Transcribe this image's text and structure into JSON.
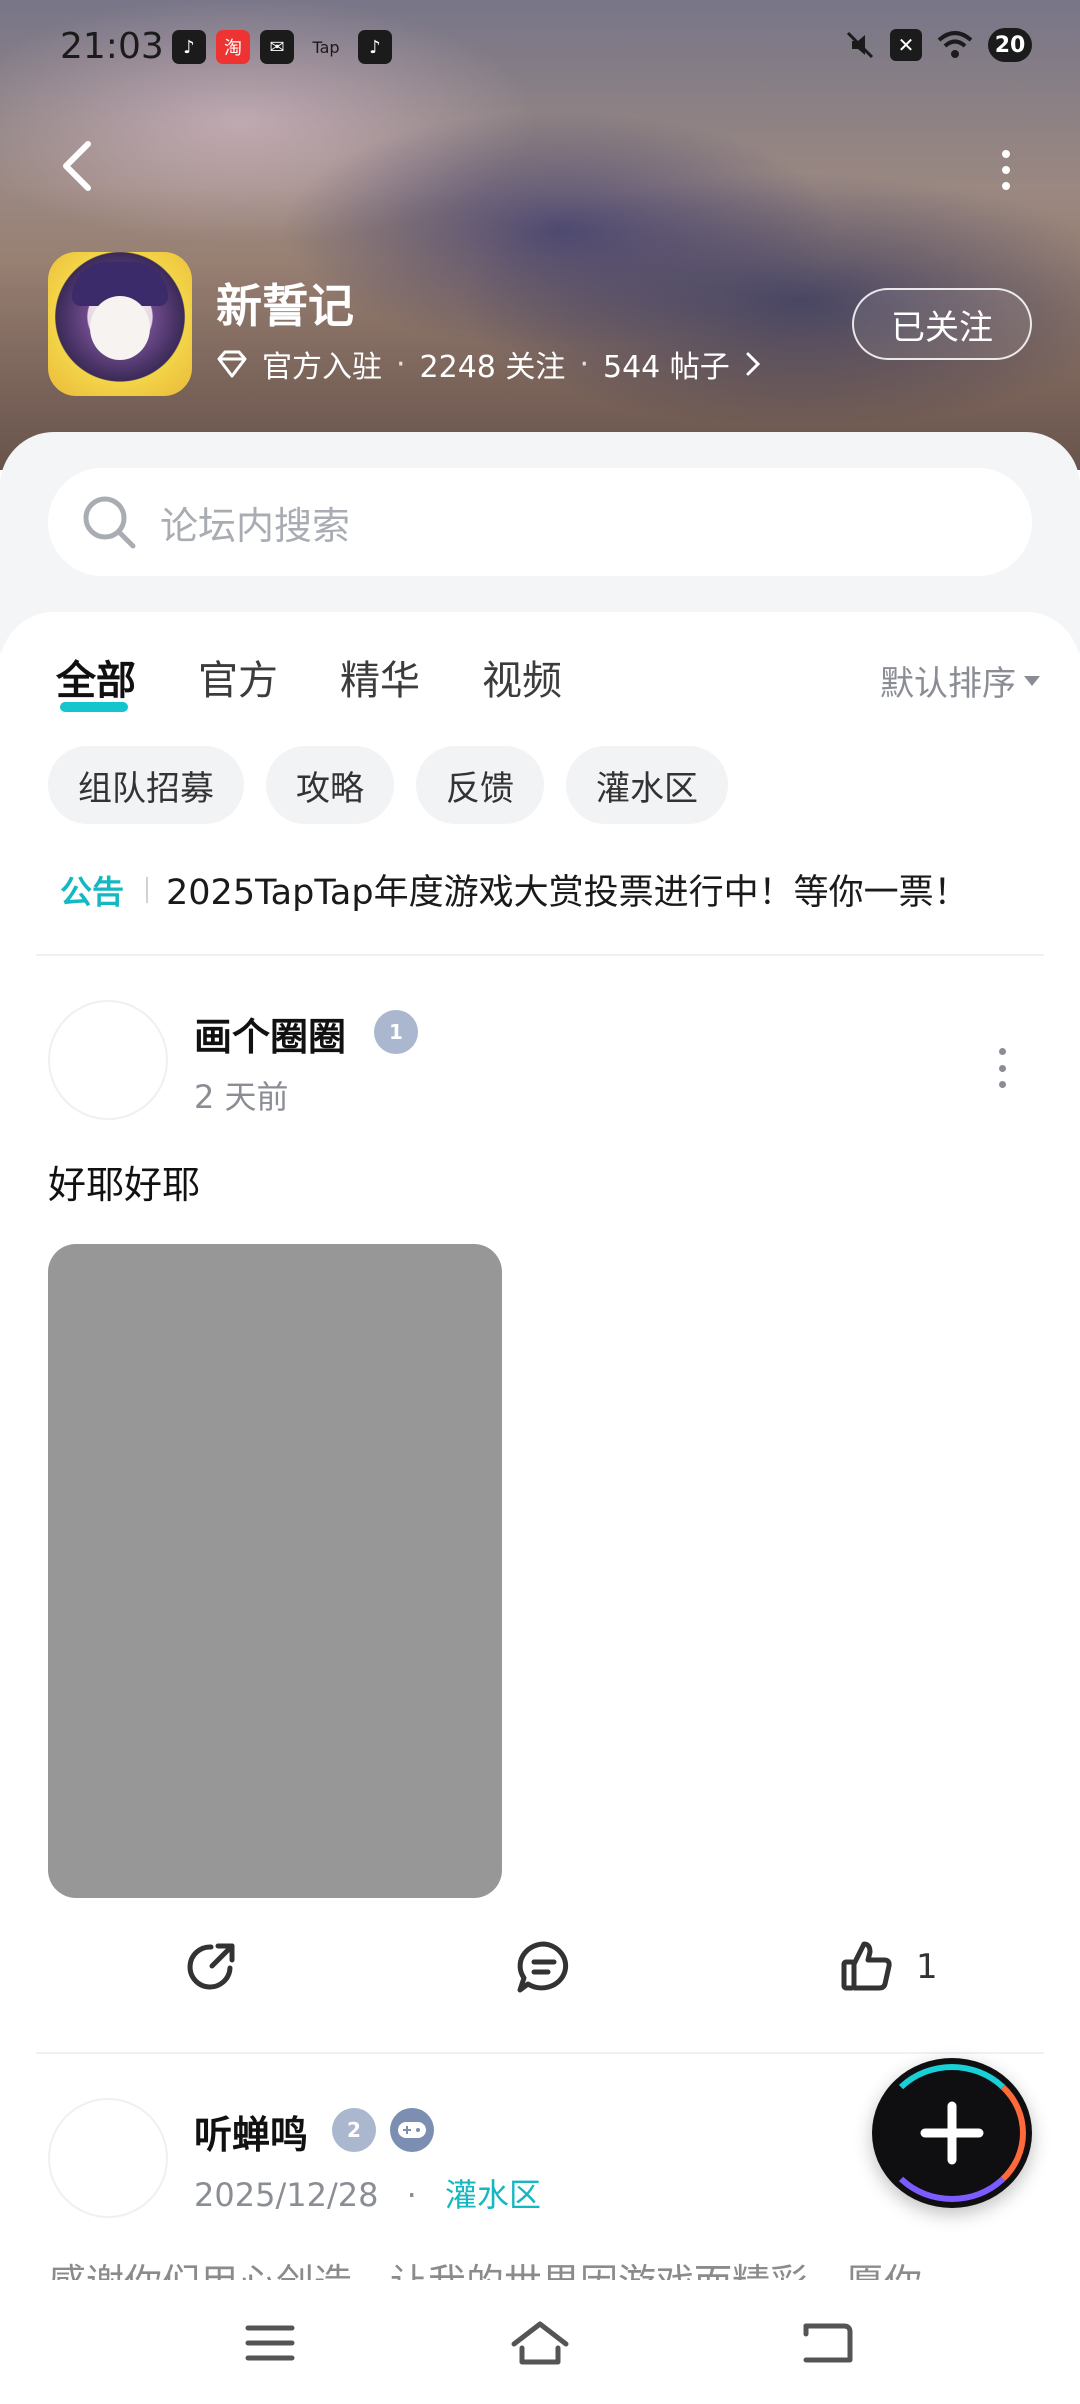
{
  "status_bar": {
    "time": "21:03",
    "apps": [
      "tiktok-icon",
      "taobao-icon",
      "mail-icon",
      "tap-icon",
      "tiktok-icon"
    ],
    "app_labels": [
      "♪",
      "淘",
      "✉",
      "Tap",
      "♪"
    ],
    "battery": "20"
  },
  "header": {
    "game_title": "新誓记",
    "official_label": "官方入驻",
    "followers": "2248 关注",
    "posts": "544 帖子",
    "follow_button": "已关注"
  },
  "search": {
    "placeholder": "论坛内搜索"
  },
  "tabs": [
    {
      "label": "全部",
      "active": true
    },
    {
      "label": "官方",
      "active": false
    },
    {
      "label": "精华",
      "active": false
    },
    {
      "label": "视频",
      "active": false
    }
  ],
  "sort_label": "默认排序",
  "chips": [
    "组队招募",
    "攻略",
    "反馈",
    "灌水区"
  ],
  "notice": {
    "tag": "公告",
    "text": "2025TapTap年度游戏大赏投票进行中！等你一票！"
  },
  "posts": [
    {
      "author": "画个圈圈",
      "level": "1",
      "time": "2 天前",
      "body": "好耶好耶",
      "likes": "1"
    },
    {
      "author": "听蝉鸣",
      "level": "2",
      "time": "2025/12/28",
      "tag": "灌水区",
      "body_preview": "感谢你们用心创造，让我的世界因游戏而精彩，愿你"
    }
  ],
  "colors": {
    "accent": "#15c5ce",
    "tag_teal": "#15b8c1",
    "image_placeholder": "#979797"
  }
}
